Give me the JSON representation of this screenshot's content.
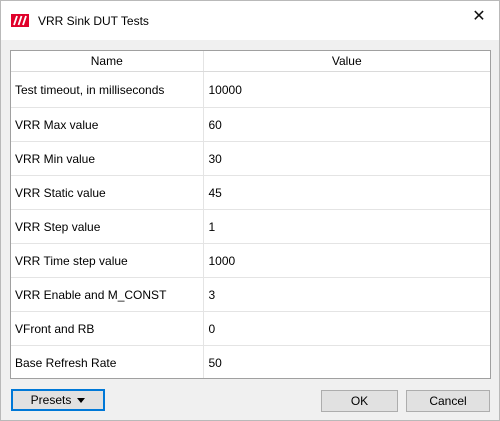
{
  "window": {
    "title": "VRR Sink DUT Tests",
    "close_glyph": "✕",
    "icon": "app-logo-icon",
    "icon_color": "#e0002a"
  },
  "grid": {
    "columns": [
      "Name",
      "Value"
    ],
    "rows": [
      {
        "name": "Test timeout, in milliseconds",
        "value": "10000"
      },
      {
        "name": "VRR Max value",
        "value": "60"
      },
      {
        "name": "VRR Min value",
        "value": "30"
      },
      {
        "name": "VRR Static value",
        "value": "45"
      },
      {
        "name": "VRR Step value",
        "value": "1"
      },
      {
        "name": "VRR Time step value",
        "value": "1000"
      },
      {
        "name": "VRR Enable and M_CONST",
        "value": "3"
      },
      {
        "name": "VFront and RB",
        "value": "0"
      },
      {
        "name": "Base Refresh Rate",
        "value": "50"
      }
    ]
  },
  "buttons": {
    "presets": "Presets",
    "ok": "OK",
    "cancel": "Cancel"
  },
  "colors": {
    "focus_border": "#0078d7",
    "button_face": "#e1e1e1",
    "dialog_bg": "#f0f0f0"
  }
}
